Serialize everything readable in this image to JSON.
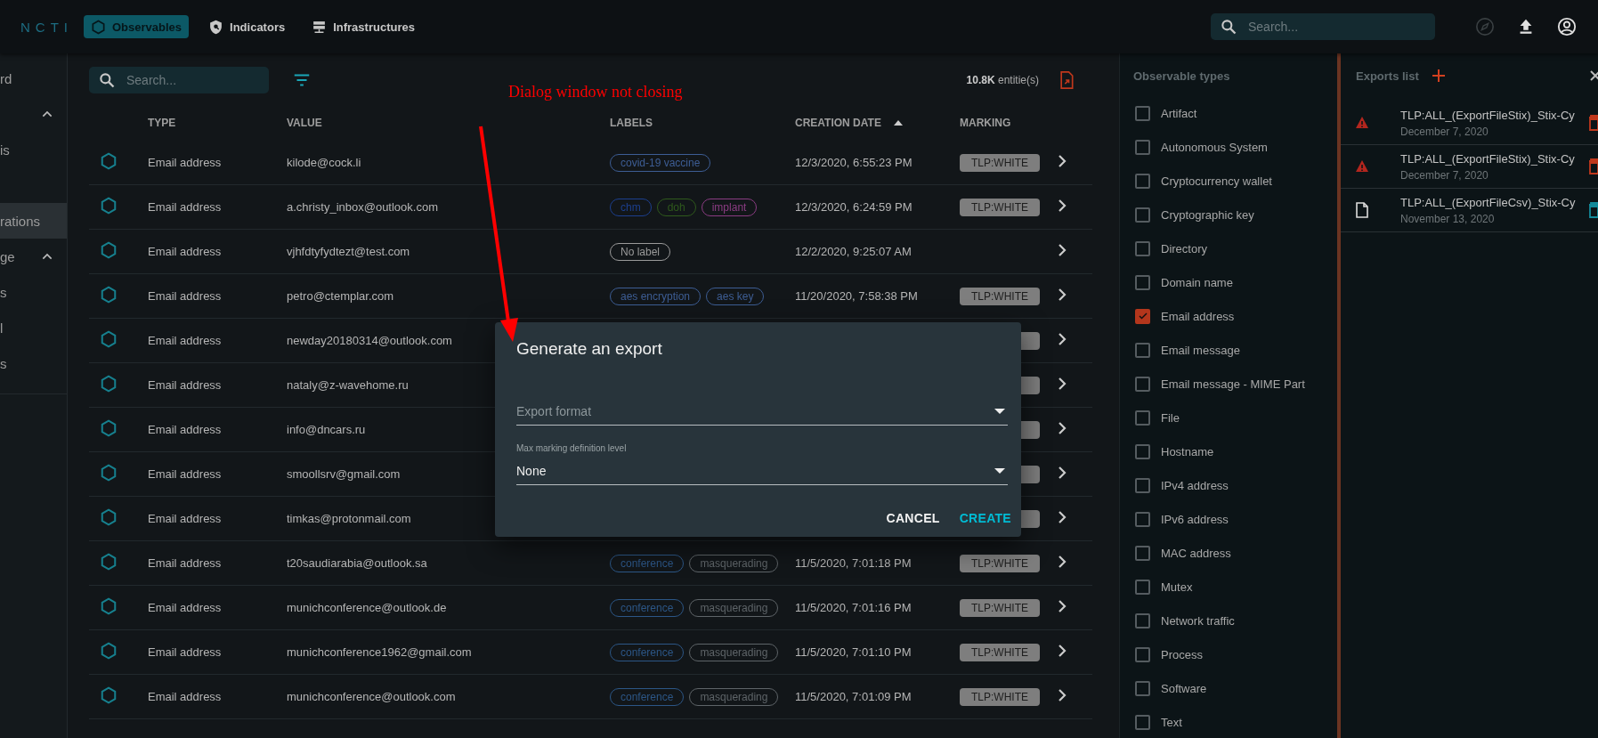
{
  "topbar": {
    "logo": "NCTI",
    "nav": [
      {
        "label": "Observables",
        "selected": true
      },
      {
        "label": "Indicators",
        "selected": false
      },
      {
        "label": "Infrastructures",
        "selected": false
      }
    ],
    "search": {
      "placeholder": "Search..."
    }
  },
  "sidebar": {
    "items": [
      {
        "label": "rd",
        "selected": false
      },
      {
        "expanded": true,
        "selected": false
      },
      {
        "label": "is",
        "selected": false
      },
      {
        "label": "rations",
        "selected": true
      },
      {
        "label": "ge",
        "expanded": true,
        "selected": false
      },
      {
        "label": "s",
        "selected": false
      },
      {
        "label": "l",
        "selected": false
      },
      {
        "label": "s",
        "selected": false
      }
    ]
  },
  "toolbar": {
    "search": {
      "placeholder": "Search..."
    },
    "count": "**10.8K** entitie(s)"
  },
  "annotation": {
    "text": "Dialog window not closing"
  },
  "table": {
    "columns": [
      {
        "label": "TYPE"
      },
      {
        "label": "VALUE"
      },
      {
        "label": "LABELS"
      },
      {
        "label": "CREATION DATE",
        "sorted": true
      },
      {
        "label": "MARKING"
      }
    ],
    "rows": [
      {
        "type": "Email address",
        "value": "kilode@cock.li",
        "labels": [
          {
            "text": "covid-19 vaccine",
            "color": "#3d5d94"
          }
        ],
        "created": "12/3/2020, 6:55:23 PM",
        "marking": "TLP:WHITE"
      },
      {
        "type": "Email address",
        "value": "a.christy_inbox@outlook.com",
        "labels": [
          {
            "text": "chm",
            "color": "#1c3f8e"
          },
          {
            "text": "doh",
            "color": "#2f5a1c"
          },
          {
            "text": "implant",
            "color": "#8a3c82"
          }
        ],
        "created": "12/3/2020, 6:24:59 PM",
        "marking": "TLP:WHITE"
      },
      {
        "type": "Email address",
        "value": "vjhfdtyfydtezt@test.com",
        "labels": [
          {
            "text": "No label",
            "color": "#9a9a9a"
          }
        ],
        "created": "12/2/2020, 9:25:07 AM"
      },
      {
        "type": "Email address",
        "value": "petro@ctemplar.com",
        "labels": [
          {
            "text": "aes encryption",
            "color": "#3d5d94"
          },
          {
            "text": "aes key",
            "color": "#3d5d94"
          }
        ],
        "created": "11/20/2020, 7:58:38 PM",
        "marking": "TLP:WHITE"
      },
      {
        "type": "Email address",
        "value": "newday20180314@outlook.com",
        "marking_covered": true
      },
      {
        "type": "Email address",
        "value": "nataly@z-wavehome.ru",
        "marking_covered": true
      },
      {
        "type": "Email address",
        "value": "info@dncars.ru",
        "marking_covered": true
      },
      {
        "type": "Email address",
        "value": "smoollsrv@gmail.com",
        "marking_covered": true
      },
      {
        "type": "Email address",
        "value": "timkas@protonmail.com",
        "marking_covered": true
      },
      {
        "type": "Email address",
        "value": "t20saudiarabia@outlook.sa",
        "labels": [
          {
            "text": "conference",
            "color": "#2c5686"
          },
          {
            "text": "masquerading",
            "color": "#5e6468"
          }
        ],
        "created": "11/5/2020, 7:01:18 PM",
        "marking": "TLP:WHITE"
      },
      {
        "type": "Email address",
        "value": "munichconference@outlook.de",
        "labels": [
          {
            "text": "conference",
            "color": "#2c5686"
          },
          {
            "text": "masquerading",
            "color": "#5e6468"
          }
        ],
        "created": "11/5/2020, 7:01:16 PM",
        "marking": "TLP:WHITE"
      },
      {
        "type": "Email address",
        "value": "munichconference1962@gmail.com",
        "labels": [
          {
            "text": "conference",
            "color": "#2c5686"
          },
          {
            "text": "masquerading",
            "color": "#5e6468"
          }
        ],
        "created": "11/5/2020, 7:01:10 PM",
        "marking": "TLP:WHITE"
      },
      {
        "type": "Email address",
        "value": "munichconference@outlook.com",
        "labels": [
          {
            "text": "conference",
            "color": "#2c5686"
          },
          {
            "text": "masquerading",
            "color": "#5e6468"
          }
        ],
        "created": "11/5/2020, 7:01:09 PM",
        "marking": "TLP:WHITE"
      }
    ]
  },
  "observable_types": {
    "title": "Observable types",
    "items": [
      {
        "label": "Artifact",
        "checked": false
      },
      {
        "label": "Autonomous System",
        "checked": false
      },
      {
        "label": "Cryptocurrency wallet",
        "checked": false
      },
      {
        "label": "Cryptographic key",
        "checked": false
      },
      {
        "label": "Directory",
        "checked": false
      },
      {
        "label": "Domain name",
        "checked": false
      },
      {
        "label": "Email address",
        "checked": true
      },
      {
        "label": "Email message",
        "checked": false
      },
      {
        "label": "Email message - MIME Part",
        "checked": false
      },
      {
        "label": "File",
        "checked": false
      },
      {
        "label": "Hostname",
        "checked": false
      },
      {
        "label": "IPv4 address",
        "checked": false
      },
      {
        "label": "IPv6 address",
        "checked": false
      },
      {
        "label": "MAC address",
        "checked": false
      },
      {
        "label": "Mutex",
        "checked": false
      },
      {
        "label": "Network traffic",
        "checked": false
      },
      {
        "label": "Process",
        "checked": false
      },
      {
        "label": "Software",
        "checked": false
      },
      {
        "label": "Text",
        "checked": false
      }
    ]
  },
  "exports": {
    "title": "Exports list",
    "items": [
      {
        "kind": "error",
        "name": "TLP:ALL_(ExportFileStix)_Stix-Cy",
        "date": "December 7, 2020"
      },
      {
        "kind": "error",
        "name": "TLP:ALL_(ExportFileStix)_Stix-Cy",
        "date": "December 7, 2020"
      },
      {
        "kind": "file",
        "name": "TLP:ALL_(ExportFileCsv)_Stix-Cy",
        "date": "November 13, 2020"
      }
    ]
  },
  "dialog": {
    "title": "Generate an export",
    "fields": [
      {
        "placeholder": "Export format"
      },
      {
        "label": "Max marking definition level",
        "value": "None"
      }
    ],
    "buttons": [
      {
        "label": "CANCEL",
        "kind": "secondary"
      },
      {
        "label": "CREATE",
        "kind": "primary"
      }
    ]
  }
}
